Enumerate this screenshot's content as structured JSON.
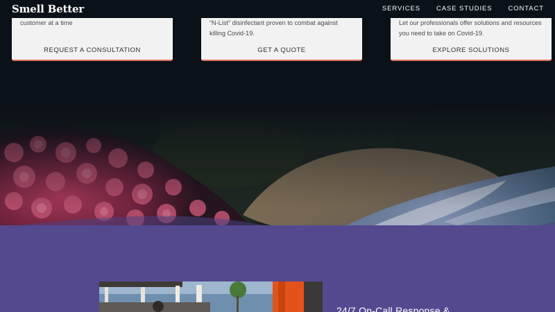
{
  "header": {
    "logo": "Smell Better",
    "nav": [
      "SERVICES",
      "CASE STUDIES",
      "CONTACT"
    ]
  },
  "cards": [
    {
      "text_lines": [
        "customer at a time"
      ],
      "cta": "REQUEST A CONSULTATION"
    },
    {
      "text_lines": [
        "“N-List” disinfectant proven to combat against",
        "killing Covid-19."
      ],
      "cta": "GET A QUOTE"
    },
    {
      "text_lines": [
        "Let our professionals offer solutions and resources",
        "you need to take on Covid-19."
      ],
      "cta": "EXPLORE SOLUTIONS"
    }
  ],
  "feature": {
    "heading": "24/7 On-Call Response &"
  },
  "colors": {
    "background": "#0b1118",
    "card": "#f2f2f2",
    "card_accent": "#e0735f",
    "purple": "#54498f"
  }
}
